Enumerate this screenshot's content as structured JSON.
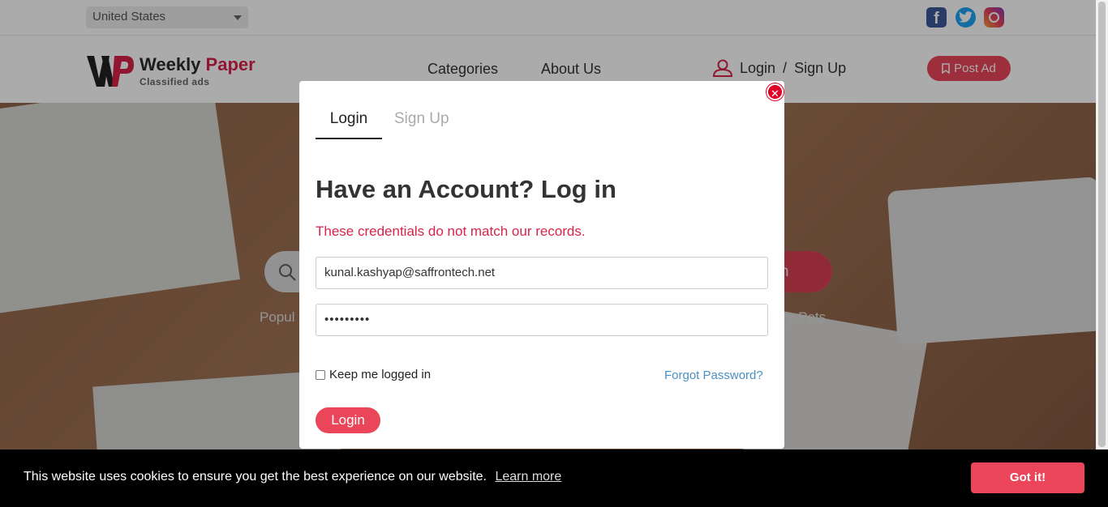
{
  "topbar": {
    "country": "United States",
    "social": [
      "facebook-icon",
      "twitter-icon",
      "instagram-icon"
    ]
  },
  "header": {
    "logo_mark": "WP",
    "logo_title_1": "Weekly",
    "logo_title_2": "Paper",
    "logo_subtitle": "Classified ads",
    "nav": [
      "Categories",
      "About Us"
    ],
    "login": "Login",
    "separator": "/",
    "signup": "Sign Up",
    "post_ad": "Post Ad"
  },
  "hero": {
    "search_button": "rch",
    "popular_prefix": "Popul",
    "tags": "elry   Pets"
  },
  "modal": {
    "tab_login": "Login",
    "tab_signup": "Sign Up",
    "title": "Have an Account? Log in",
    "error": "These credentials do not match our records.",
    "email_value": "kunal.kashyap@saffrontech.net",
    "password_value": "•••••••••",
    "keep_logged_in": "Keep me logged in",
    "forgot_password": "Forgot Password?",
    "login_button": "Login",
    "close_symbol": "✕"
  },
  "cookie": {
    "message": "This website uses cookies to ensure you get the best experience on our website.",
    "learn_more": "Learn more",
    "accept": "Got it!"
  },
  "colors": {
    "accent": "#ea4559",
    "error": "#d8234a",
    "link": "#4a90c4"
  }
}
